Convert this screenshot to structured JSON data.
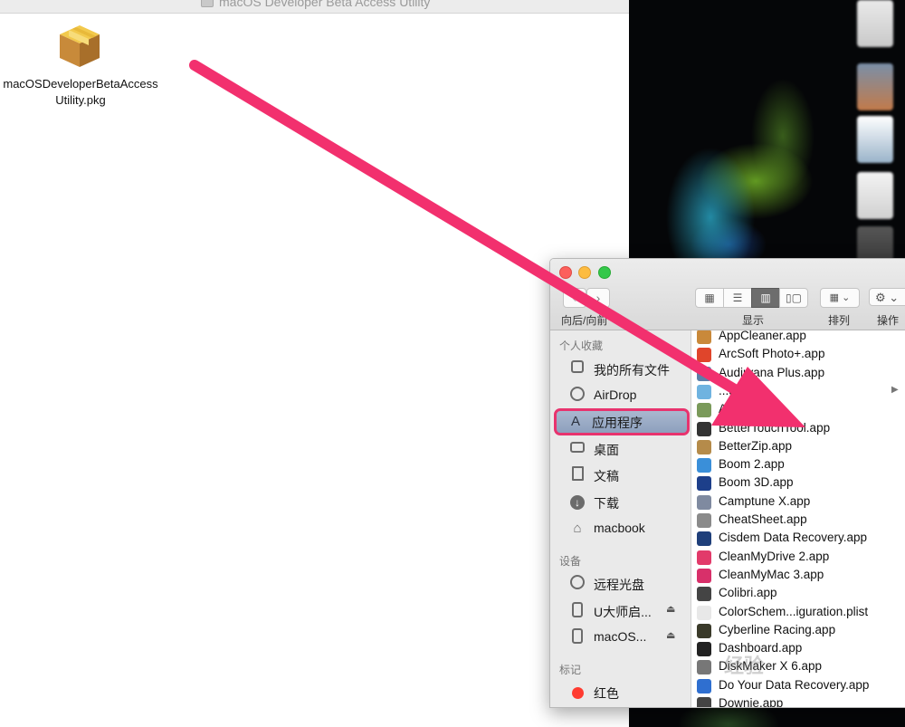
{
  "dmg_window": {
    "title": "macOS Developer Beta Access Utility",
    "item": {
      "label": "macOSDeveloperBetaAccessUtility.pkg",
      "icon": "package-icon"
    }
  },
  "finder": {
    "toolbar": {
      "nav_label": "向后/向前",
      "view_label": "显示",
      "arrange_label": "排列",
      "action_label": "操作"
    },
    "sidebar": {
      "favorites_header": "个人收藏",
      "favorites": [
        {
          "label": "我的所有文件",
          "icon": "all-files-icon"
        },
        {
          "label": "AirDrop",
          "icon": "airdrop-icon"
        },
        {
          "label": "应用程序",
          "icon": "applications-icon",
          "selected": true
        },
        {
          "label": "桌面",
          "icon": "desktop-icon"
        },
        {
          "label": "文稿",
          "icon": "documents-icon"
        },
        {
          "label": "下载",
          "icon": "downloads-icon"
        },
        {
          "label": "macbook",
          "icon": "home-icon"
        }
      ],
      "devices_header": "设备",
      "devices": [
        {
          "label": "远程光盘",
          "icon": "remote-disc-icon"
        },
        {
          "label": "U大师启...",
          "icon": "drive-icon",
          "eject": "⏏"
        },
        {
          "label": "macOS...",
          "icon": "drive-icon",
          "eject": "⏏"
        }
      ],
      "tags_header": "标记",
      "tags": [
        {
          "label": "红色",
          "color": "#ff3b30"
        }
      ]
    },
    "files": [
      {
        "name": "AppCleaner.app",
        "color": "#c9893a"
      },
      {
        "name": "ArcSoft Photo+.app",
        "color": "#e0452b"
      },
      {
        "name": "Audirvana Plus.app",
        "color": "#5b7fa8"
      },
      {
        "name": "...disk",
        "color": "#6fb3e0",
        "folder": true
      },
      {
        "name": "Au...or.app",
        "color": "#7a9a5a"
      },
      {
        "name": "BetterTouchTool.app",
        "color": "#333333"
      },
      {
        "name": "BetterZip.app",
        "color": "#b58b4a"
      },
      {
        "name": "Boom 2.app",
        "color": "#3a8fd9"
      },
      {
        "name": "Boom 3D.app",
        "color": "#1d3f8a"
      },
      {
        "name": "Camptune X.app",
        "color": "#7f8aa0"
      },
      {
        "name": "CheatSheet.app",
        "color": "#8a8a8a"
      },
      {
        "name": "Cisdem Data Recovery.app",
        "color": "#1f3f7a"
      },
      {
        "name": "CleanMyDrive 2.app",
        "color": "#e23a6a"
      },
      {
        "name": "CleanMyMac 3.app",
        "color": "#d8306a"
      },
      {
        "name": "Colibri.app",
        "color": "#444444"
      },
      {
        "name": "ColorSchem...iguration.plist",
        "color": "#e8e8e8"
      },
      {
        "name": "Cyberline Racing.app",
        "color": "#3a3a2a"
      },
      {
        "name": "Dashboard.app",
        "color": "#222222"
      },
      {
        "name": "DiskMaker X 6.app",
        "color": "#777777"
      },
      {
        "name": "Do Your Data Recovery.app",
        "color": "#2f6fd0"
      },
      {
        "name": "Downie.app",
        "color": "#444444"
      }
    ]
  },
  "annotation": {
    "arrow_color": "#f2306e",
    "watermark": "经验"
  }
}
